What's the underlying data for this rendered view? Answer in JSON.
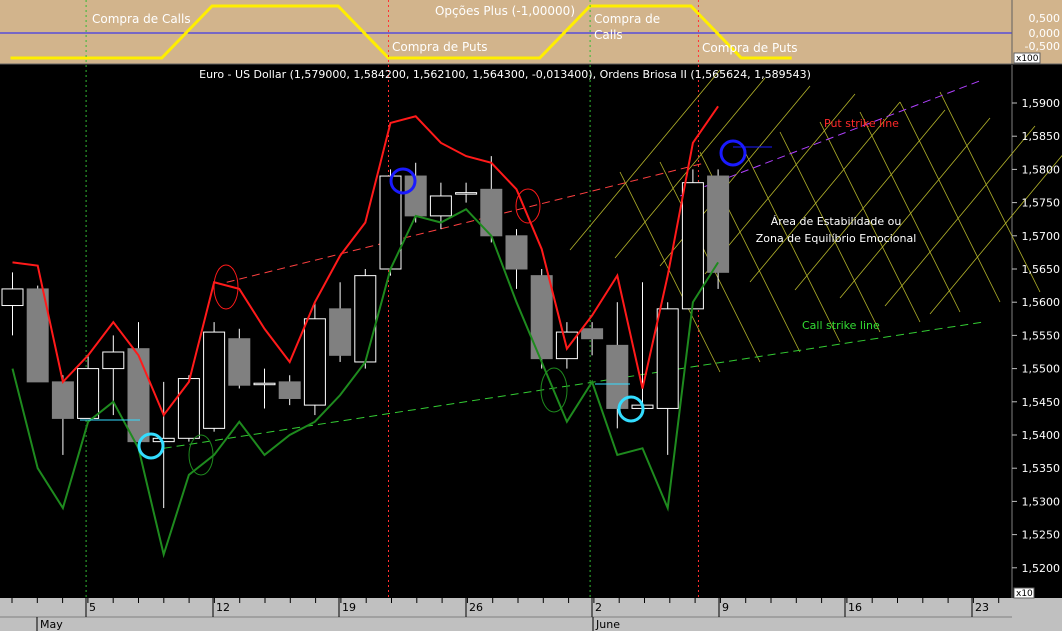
{
  "top_panel": {
    "title": "Opções Plus (-1,00000)",
    "labels": [
      "Compra de Calls",
      "Compra de Puts",
      "Compra de Calls",
      "Compra de Puts"
    ],
    "scale_label": "x100",
    "y_ticks": [
      "0,500",
      "0,000",
      "-0,500"
    ],
    "signal": [
      [
        0,
        0
      ],
      [
        6,
        0
      ],
      [
        8,
        1
      ],
      [
        13,
        1
      ],
      [
        15,
        0
      ],
      [
        21,
        0
      ],
      [
        23,
        1
      ],
      [
        27,
        1
      ],
      [
        29,
        0
      ],
      [
        31,
        0
      ]
    ]
  },
  "main_panel": {
    "title": "Euro - US Dollar (1,579000, 1,584200, 1,562100, 1,564300, -0,013400), Ordens Briosa II (1,565624, 1,589543)",
    "y_ticks": [
      "1,5900",
      "1,5850",
      "1,5800",
      "1,5750",
      "1,5700",
      "1,5650",
      "1,5600",
      "1,5550",
      "1,5500",
      "1,5450",
      "1,5400",
      "1,5350",
      "1,5300",
      "1,5250",
      "1,5200"
    ],
    "x_scale_label": "x10",
    "x_ticks": [
      "5",
      "12",
      "19",
      "26",
      "2",
      "9",
      "16",
      "23"
    ],
    "months": [
      "May",
      "June"
    ],
    "annotations": {
      "put_strike": "Put strike line",
      "call_strike": "Call strike line",
      "zone_line1": "Área de Estabilidade ou",
      "zone_line2": "Zona de Equilíbrio Emocional"
    }
  },
  "colors": {
    "top_bg": "#d2b48c",
    "main_bg": "#000000",
    "axis_bg": "#c0c0c0",
    "put_line": "#ff1a1a",
    "call_line": "#1e8a1e",
    "signal": "#ffee00",
    "bull_candle": "#000000",
    "bear_candle": "#808080",
    "marker_blue": "#1a1aff",
    "marker_cyan": "#33ddff",
    "zone_grid": "#b5b52a",
    "trend_put": "#ff4040",
    "trend_call": "#33cc33",
    "trend_purple": "#b040ff"
  },
  "chart_data": {
    "type": "candlestick",
    "title": "Euro - US Dollar (1,579000, 1,584200, 1,562100, 1,564300, -0,013400), Ordens Briosa II (1,565624, 1,589543)",
    "ylim": [
      1.517,
      1.5945
    ],
    "candles": [
      {
        "o": 1.5595,
        "h": 1.5645,
        "l": 1.555,
        "c": 1.562
      },
      {
        "o": 1.562,
        "h": 1.5625,
        "l": 1.548,
        "c": 1.548
      },
      {
        "o": 1.548,
        "h": 1.549,
        "l": 1.537,
        "c": 1.5425
      },
      {
        "o": 1.5425,
        "h": 1.552,
        "l": 1.5425,
        "c": 1.55
      },
      {
        "o": 1.55,
        "h": 1.555,
        "l": 1.543,
        "c": 1.5525
      },
      {
        "o": 1.553,
        "h": 1.557,
        "l": 1.538,
        "c": 1.539
      },
      {
        "o": 1.539,
        "h": 1.548,
        "l": 1.529,
        "c": 1.5395
      },
      {
        "o": 1.5395,
        "h": 1.549,
        "l": 1.539,
        "c": 1.5485
      },
      {
        "o": 1.541,
        "h": 1.557,
        "l": 1.5405,
        "c": 1.5555
      },
      {
        "o": 1.5545,
        "h": 1.556,
        "l": 1.547,
        "c": 1.5475
      },
      {
        "o": 1.5478,
        "h": 1.55,
        "l": 1.544,
        "c": 1.5478
      },
      {
        "o": 1.548,
        "h": 1.549,
        "l": 1.5445,
        "c": 1.5455
      },
      {
        "o": 1.5445,
        "h": 1.56,
        "l": 1.543,
        "c": 1.5575
      },
      {
        "o": 1.559,
        "h": 1.563,
        "l": 1.551,
        "c": 1.552
      },
      {
        "o": 1.551,
        "h": 1.565,
        "l": 1.55,
        "c": 1.564
      },
      {
        "o": 1.565,
        "h": 1.58,
        "l": 1.564,
        "c": 1.579
      },
      {
        "o": 1.579,
        "h": 1.581,
        "l": 1.572,
        "c": 1.573
      },
      {
        "o": 1.573,
        "h": 1.578,
        "l": 1.571,
        "c": 1.576
      },
      {
        "o": 1.5765,
        "h": 1.578,
        "l": 1.575,
        "c": 1.5765
      },
      {
        "o": 1.577,
        "h": 1.582,
        "l": 1.569,
        "c": 1.57
      },
      {
        "o": 1.57,
        "h": 1.571,
        "l": 1.562,
        "c": 1.565
      },
      {
        "o": 1.564,
        "h": 1.565,
        "l": 1.55,
        "c": 1.5515
      },
      {
        "o": 1.5515,
        "h": 1.557,
        "l": 1.55,
        "c": 1.5555
      },
      {
        "o": 1.556,
        "h": 1.557,
        "l": 1.552,
        "c": 1.5545
      },
      {
        "o": 1.5535,
        "h": 1.56,
        "l": 1.541,
        "c": 1.544
      },
      {
        "o": 1.544,
        "h": 1.563,
        "l": 1.544,
        "c": 1.5445
      },
      {
        "o": 1.544,
        "h": 1.56,
        "l": 1.537,
        "c": 1.559
      },
      {
        "o": 1.559,
        "h": 1.58,
        "l": 1.559,
        "c": 1.578
      },
      {
        "o": 1.579,
        "h": 1.58,
        "l": 1.562,
        "c": 1.5645
      }
    ],
    "put_line": [
      1.566,
      1.5655,
      1.548,
      1.552,
      1.557,
      1.552,
      1.543,
      1.548,
      1.563,
      1.562,
      1.556,
      1.551,
      1.56,
      1.567,
      1.572,
      1.587,
      1.588,
      1.584,
      1.582,
      1.581,
      1.577,
      1.568,
      1.553,
      1.558,
      1.564,
      1.547,
      1.564,
      1.584,
      1.5895
    ],
    "call_line": [
      1.55,
      1.535,
      1.529,
      1.542,
      1.545,
      1.538,
      1.522,
      1.534,
      1.537,
      1.542,
      1.537,
      1.54,
      1.542,
      1.546,
      1.551,
      1.565,
      1.573,
      1.572,
      1.574,
      1.57,
      1.56,
      1.551,
      1.542,
      1.548,
      1.537,
      1.538,
      1.529,
      1.56,
      1.566
    ],
    "trendlines": [
      {
        "name": "Put strike line",
        "from": [
          8.5,
          1.563
        ],
        "to": [
          27.5,
          1.581
        ]
      },
      {
        "name": "Call strike line",
        "from": [
          6,
          1.538
        ],
        "to": [
          38.5,
          1.557
        ]
      },
      {
        "name": "",
        "from": [
          26.5,
          1.576
        ],
        "to": [
          38.5,
          1.5935
        ]
      }
    ]
  }
}
